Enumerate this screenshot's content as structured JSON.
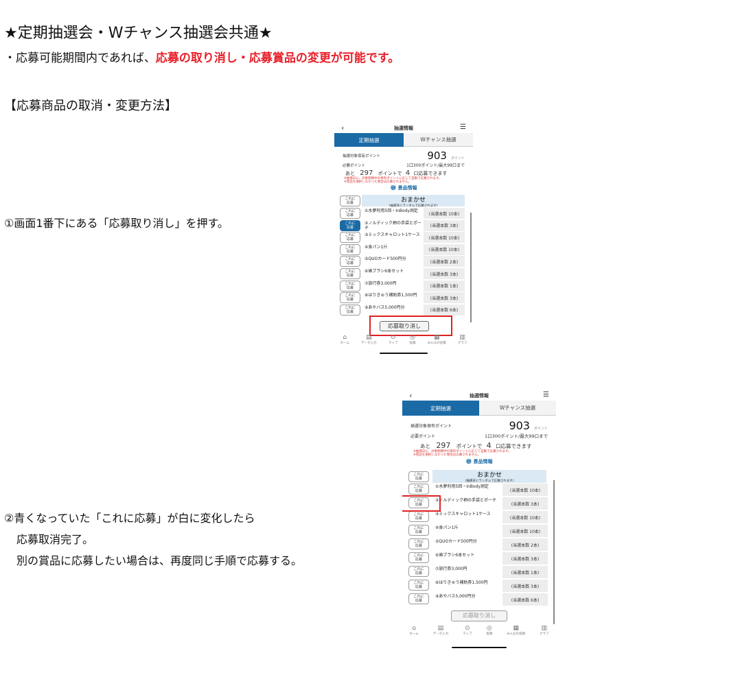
{
  "heading": "★定期抽選会・Wチャンス抽選会共通★",
  "intro": {
    "prefix": "・応募可能期間内であれば、",
    "emphasis": "応募の取り消し・応募賞品の変更が可能です。"
  },
  "section_title": "【応募商品の取消・変更方法】",
  "step1": "①画面1番下にある「応募取り消し」を押す。",
  "step2": {
    "line1": "②青くなっていた「これに応募」が白に変化したら",
    "line2": "応募取消完了。",
    "line3": "別の賞品に応募したい場合は、再度同じ手順で応募する。"
  },
  "phone": {
    "back_icon": "chevron-left-icon",
    "title": "抽選情報",
    "menu_icon": "hamburger-menu-icon",
    "tabs": [
      "定期抽選",
      "Wチャンス抽選"
    ],
    "points_label": "抽選対象保有ポイント",
    "points_value": "903",
    "points_unit": "ポイント",
    "required_label": "必要ポイント",
    "required_value": "1口300ポイント/最大99口まで",
    "remain_prefix": "あと",
    "remain_value": "297",
    "remain_mid": "ポイントで",
    "remain_count": "4",
    "remain_suffix": "口応募できます",
    "note1": "※抽選日に、対象期間中の保有ポイントに応じて自動で応募されます。",
    "note2": "※景品を選択しなかった場合は応募されません。",
    "prize_title": "景品情報",
    "apply_label_1": "これに",
    "apply_label_2": "応募",
    "omakase_title": "おまかせ",
    "omakase_sub": "(抽選日にランダムで応募されます)",
    "prizes": [
      {
        "name": "①水夢利用5回・InBody測定",
        "count": "(当選本数 10本)"
      },
      {
        "name": "②ノルディック柄の手袋とポーチ",
        "count": "(当選本数 3本)"
      },
      {
        "name": "③ミックスキャロット1ケース",
        "count": "(当選本数 10本)"
      },
      {
        "name": "④食パン1斤",
        "count": "(当選本数 10本)"
      },
      {
        "name": "⑤QUOカード500円分",
        "count": "(当選本数 2本)"
      },
      {
        "name": "⑥歯ブラシ6本セット",
        "count": "(当選本数 3本)"
      },
      {
        "name": "⑦旅行券3,000円",
        "count": "(当選本数 1本)"
      },
      {
        "name": "⑧はりきゅう補助券1,500円",
        "count": "(当選本数 3本)"
      },
      {
        "name": "⑨あやバス5,000円分",
        "count": "(当選本数 6本)"
      }
    ],
    "cancel_label": "応募取り消し",
    "nav": [
      {
        "icon": "home-icon",
        "label": "ホーム"
      },
      {
        "icon": "document-icon",
        "label": "データ入力"
      },
      {
        "icon": "map-pin-icon",
        "label": "マップ"
      },
      {
        "icon": "camera-icon",
        "label": "投稿"
      },
      {
        "icon": "grid-icon",
        "label": "みんなの投稿"
      },
      {
        "icon": "bar-chart-icon",
        "label": "グラフ"
      }
    ]
  }
}
